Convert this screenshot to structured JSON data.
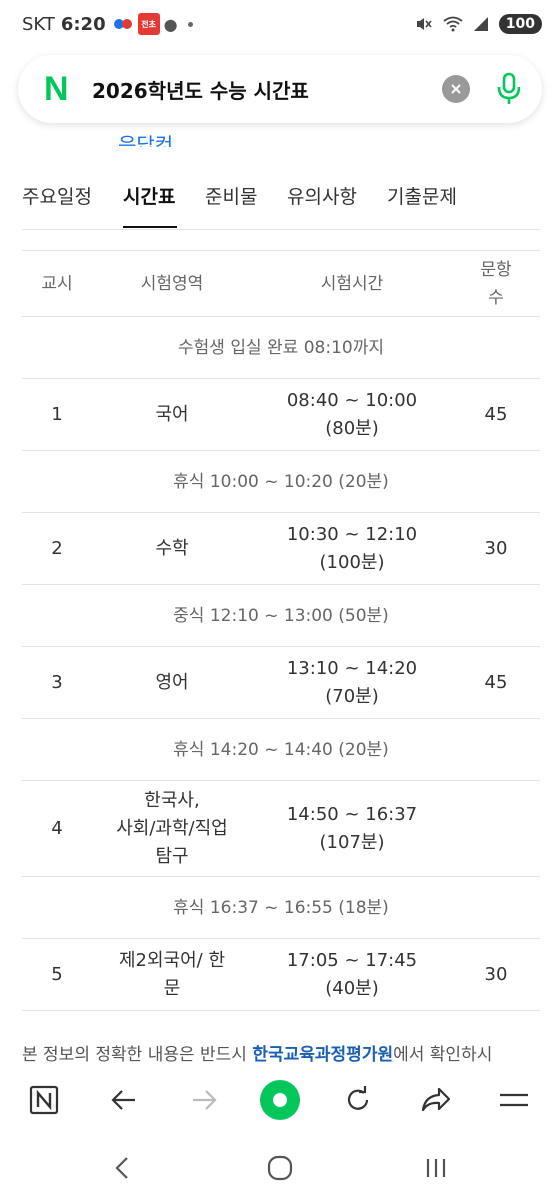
{
  "status_bar": {
    "carrier": "SKT",
    "time": "6:20",
    "news_badge": "전초",
    "battery": "100"
  },
  "search": {
    "logo": "N",
    "query": "2026학년도 수능 시간표"
  },
  "tabs": [
    {
      "label": "주요일정",
      "active": false
    },
    {
      "label": "시간표",
      "active": true
    },
    {
      "label": "준비물",
      "active": false
    },
    {
      "label": "유의사항",
      "active": false
    },
    {
      "label": "기출문제",
      "active": false
    }
  ],
  "cut_text": "응답컷",
  "table": {
    "headers": [
      "교시",
      "시험영역",
      "시험시간",
      "문항\n수"
    ],
    "rows": [
      {
        "type": "note",
        "text": "수험생 입실 완료 08:10까지"
      },
      {
        "type": "data",
        "period": "1",
        "subject": "국어",
        "time": "08:40 ~ 10:00\n(80분)",
        "questions": "45"
      },
      {
        "type": "note",
        "text": "휴식 10:00 ~ 10:20 (20분)"
      },
      {
        "type": "data",
        "period": "2",
        "subject": "수학",
        "time": "10:30 ~ 12:10\n(100분)",
        "questions": "30"
      },
      {
        "type": "note",
        "text": "중식 12:10 ~ 13:00 (50분)"
      },
      {
        "type": "data",
        "period": "3",
        "subject": "영어",
        "time": "13:10 ~ 14:20\n(70분)",
        "questions": "45"
      },
      {
        "type": "note",
        "text": "휴식 14:20 ~ 14:40 (20분)"
      },
      {
        "type": "data",
        "period": "4",
        "subject": "한국사,\n사회/과학/직업\n탐구",
        "time": "14:50 ~ 16:37\n(107분)",
        "questions": ""
      },
      {
        "type": "note",
        "text": "휴식 16:37 ~ 16:55 (18분)"
      },
      {
        "type": "data",
        "period": "5",
        "subject": "제2외국어/ 한\n문",
        "time": "17:05 ~ 17:45\n(40분)",
        "questions": "30"
      }
    ]
  },
  "footer": {
    "prefix": "본 정보의 정확한 내용은 반드시 ",
    "link": "한국교육과정평가원",
    "suffix": "에서 확인하시"
  },
  "colors": {
    "naver_green": "#03c75a",
    "link_blue": "#1a5fb4"
  },
  "icons": [
    "naver-home-icon",
    "back-arrow-icon",
    "forward-arrow-icon",
    "naver-whale-icon",
    "refresh-icon",
    "share-icon",
    "menu-icon"
  ]
}
